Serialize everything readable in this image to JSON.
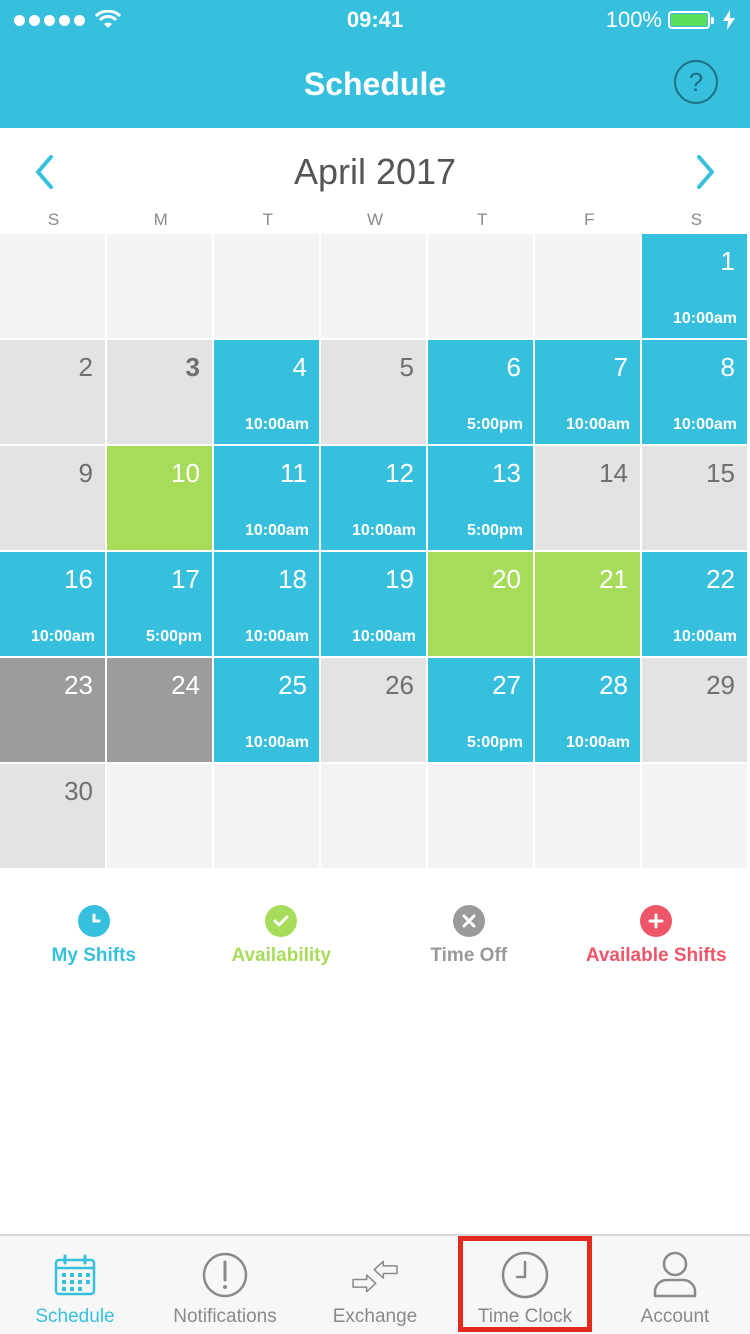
{
  "status": {
    "time": "09:41",
    "battery": "100%",
    "icons": [
      "signal-dots",
      "wifi-icon",
      "battery-icon",
      "charging-bolt-icon"
    ]
  },
  "nav": {
    "title": "Schedule",
    "help_label": "?"
  },
  "calendar": {
    "month_title": "April 2017",
    "weekdays": [
      "S",
      "M",
      "T",
      "W",
      "T",
      "F",
      "S"
    ],
    "weeks": [
      [
        {
          "day": "",
          "type": "empty"
        },
        {
          "day": "",
          "type": "empty"
        },
        {
          "day": "",
          "type": "empty"
        },
        {
          "day": "",
          "type": "empty"
        },
        {
          "day": "",
          "type": "empty"
        },
        {
          "day": "",
          "type": "empty"
        },
        {
          "day": "1",
          "type": "shift",
          "time": "10:00am"
        }
      ],
      [
        {
          "day": "2",
          "type": "none"
        },
        {
          "day": "3",
          "type": "none",
          "bold": true
        },
        {
          "day": "4",
          "type": "shift",
          "time": "10:00am"
        },
        {
          "day": "5",
          "type": "none"
        },
        {
          "day": "6",
          "type": "shift",
          "time": "5:00pm"
        },
        {
          "day": "7",
          "type": "shift",
          "time": "10:00am"
        },
        {
          "day": "8",
          "type": "shift",
          "time": "10:00am"
        }
      ],
      [
        {
          "day": "9",
          "type": "none"
        },
        {
          "day": "10",
          "type": "avail"
        },
        {
          "day": "11",
          "type": "shift",
          "time": "10:00am"
        },
        {
          "day": "12",
          "type": "shift",
          "time": "10:00am"
        },
        {
          "day": "13",
          "type": "shift",
          "time": "5:00pm"
        },
        {
          "day": "14",
          "type": "none"
        },
        {
          "day": "15",
          "type": "none"
        }
      ],
      [
        {
          "day": "16",
          "type": "shift",
          "time": "10:00am"
        },
        {
          "day": "17",
          "type": "shift",
          "time": "5:00pm"
        },
        {
          "day": "18",
          "type": "shift",
          "time": "10:00am"
        },
        {
          "day": "19",
          "type": "shift",
          "time": "10:00am"
        },
        {
          "day": "20",
          "type": "avail"
        },
        {
          "day": "21",
          "type": "avail"
        },
        {
          "day": "22",
          "type": "shift",
          "time": "10:00am"
        }
      ],
      [
        {
          "day": "23",
          "type": "off"
        },
        {
          "day": "24",
          "type": "off"
        },
        {
          "day": "25",
          "type": "shift",
          "time": "10:00am"
        },
        {
          "day": "26",
          "type": "none"
        },
        {
          "day": "27",
          "type": "shift",
          "time": "5:00pm"
        },
        {
          "day": "28",
          "type": "shift",
          "time": "10:00am"
        },
        {
          "day": "29",
          "type": "none"
        }
      ],
      [
        {
          "day": "30",
          "type": "none"
        },
        {
          "day": "",
          "type": "empty"
        },
        {
          "day": "",
          "type": "empty"
        },
        {
          "day": "",
          "type": "empty"
        },
        {
          "day": "",
          "type": "empty"
        },
        {
          "day": "",
          "type": "empty"
        },
        {
          "day": "",
          "type": "empty"
        }
      ]
    ]
  },
  "legend": [
    {
      "label": "My Shifts",
      "color": "#37c0de",
      "icon": "clock-icon"
    },
    {
      "label": "Availability",
      "color": "#a7dc5b",
      "icon": "check-icon"
    },
    {
      "label": "Time Off",
      "color": "#9a9a9a",
      "icon": "x-icon"
    },
    {
      "label": "Available Shifts",
      "color": "#ef5569",
      "icon": "plus-icon"
    }
  ],
  "tabs": [
    {
      "label": "Schedule",
      "icon": "calendar-icon",
      "active": true
    },
    {
      "label": "Notifications",
      "icon": "alert-icon",
      "active": false
    },
    {
      "label": "Exchange",
      "icon": "exchange-icon",
      "active": false
    },
    {
      "label": "Time Clock",
      "icon": "clock-icon",
      "active": false
    },
    {
      "label": "Account",
      "icon": "user-icon",
      "active": false
    }
  ],
  "colors": {
    "accent": "#37c0de",
    "availability": "#a7dc5b",
    "time_off": "#9c9c9c",
    "available_shifts": "#ef5569",
    "highlight_box": "#e42a1c"
  }
}
